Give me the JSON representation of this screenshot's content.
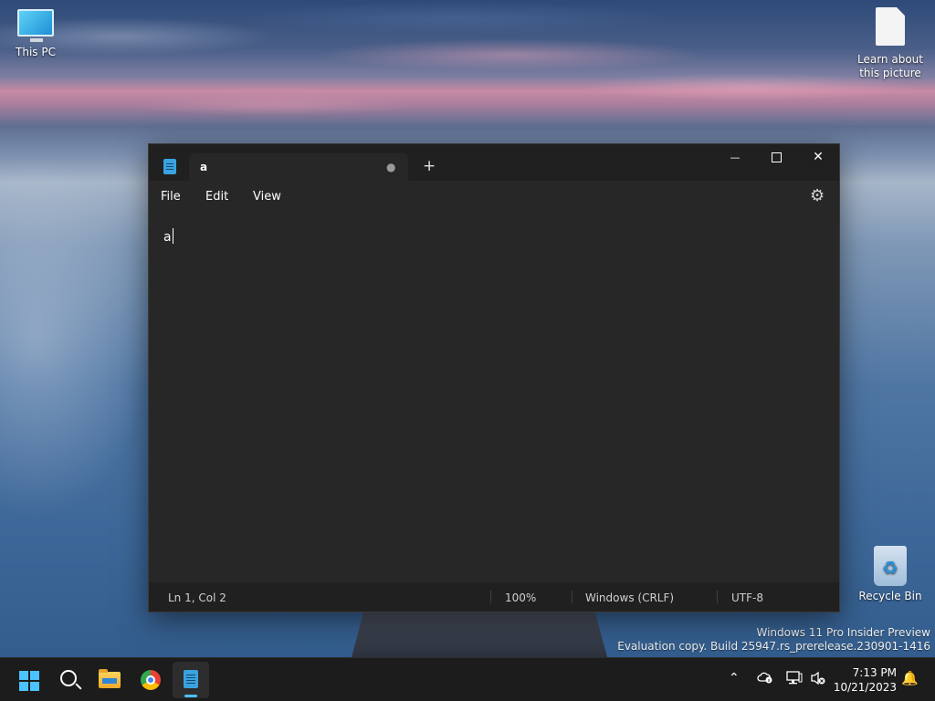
{
  "desktop": {
    "icons": {
      "this_pc": "This PC",
      "learn_line1": "Learn about",
      "learn_line2": "this picture",
      "recycle_bin": "Recycle Bin"
    },
    "watermark": {
      "line1": "Windows 11 Pro Insider Preview",
      "line2": "Evaluation copy. Build 25947.rs_prerelease.230901-1416"
    }
  },
  "notepad": {
    "tab": {
      "title": "a",
      "unsaved_indicator": "●"
    },
    "new_tab_label": "+",
    "caption": {
      "minimize": "—",
      "close": "✕"
    },
    "menu": {
      "file": "File",
      "edit": "Edit",
      "view": "View"
    },
    "settings_icon": "⚙",
    "editor_text": "a",
    "status": {
      "position": "Ln 1, Col 2",
      "zoom": "100%",
      "line_ending": "Windows (CRLF)",
      "encoding": "UTF-8"
    }
  },
  "taskbar": {
    "apps": [
      "start-icon",
      "search-icon",
      "file-explorer-icon",
      "chrome-icon",
      "notepad-icon"
    ],
    "tray": {
      "chevron": "⌃",
      "bell": "🔔"
    },
    "clock": {
      "time": "7:13 PM",
      "date": "10/21/2023"
    }
  },
  "colors": {
    "accent": "#4cc2ff",
    "window_bg": "#272727",
    "titlebar_bg": "#202020",
    "taskbar_bg": "#1c1c1c"
  }
}
